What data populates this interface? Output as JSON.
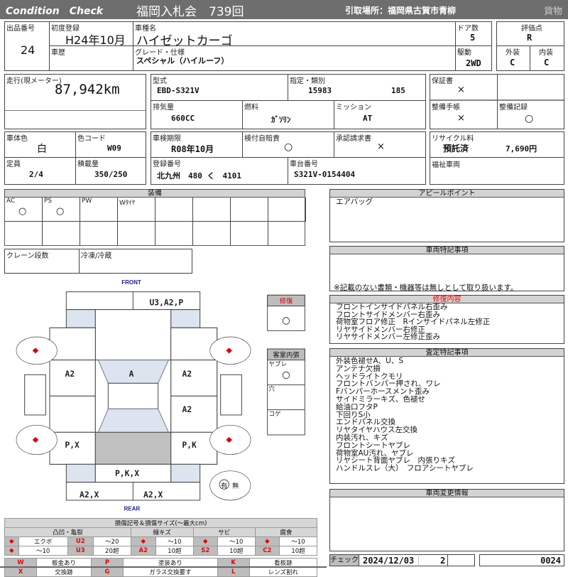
{
  "header": {
    "brand": "Condition　Check",
    "auction": "福岡入札会　739回",
    "pickup": "引取場所：福岡県古賀市青柳",
    "category": "貨物"
  },
  "vehicle": {
    "lot_label": "出品番号",
    "lot": "24",
    "first_reg_label": "初度登録",
    "first_reg": "H24年10月",
    "model_name_label": "車種名",
    "model_name": "ハイゼットカーゴ",
    "doors_label": "ドア数",
    "doors": "5",
    "score_label": "評価点",
    "score": "R",
    "history_label": "車歴",
    "grade_label": "グレード・仕様",
    "grade": "スペシャル（ハイルーフ）",
    "drive_label": "駆動",
    "drive": "2WD",
    "exterior_label": "外装",
    "exterior": "C",
    "interior_label": "内装",
    "interior": "C",
    "mileage_label": "走行(現メーター)",
    "mileage": "87,942km",
    "type_label": "型式",
    "type": "EBD-S321V",
    "designation_label": "指定・類別",
    "designation": "15983",
    "classification": "185",
    "displacement_label": "排気量",
    "displacement": "660CC",
    "fuel_label": "燃料",
    "fuel": "ｶﾞｿﾘﾝ",
    "mission_label": "ミッション",
    "mission": "AT",
    "warranty_label": "保証書",
    "warranty": "×",
    "maint_book_label": "整備手帳",
    "maint_book": "×",
    "maint_record_label": "整備記録",
    "maint_record": "○",
    "color_label": "車体色",
    "color": "白",
    "color_code_label": "色コード",
    "color_code": "W09",
    "inspection_label": "車検期限",
    "inspection": "R08年10月",
    "insurance_label": "検付自賠責",
    "insurance": "○",
    "approval_label": "承認請求書",
    "approval": "×",
    "recycle_label": "リサイクル料",
    "recycle_status": "預託済",
    "recycle_fee": "7,690円",
    "capacity_label": "定員",
    "capacity": "2/4",
    "load_label": "積載量",
    "load": "350/250",
    "plate_label": "登録番号",
    "plate": "北九州　480 く　4101",
    "chassis_label": "車台番号",
    "chassis": "S321V-0154404",
    "welfare_label": "福祉車両"
  },
  "equipment": {
    "title": "装備",
    "items": [
      {
        "label": "AC",
        "value": "○"
      },
      {
        "label": "PS",
        "value": "○"
      },
      {
        "label": "PW",
        "value": ""
      },
      {
        "label": "Wﾀｲﾔ",
        "value": ""
      }
    ],
    "crane_label": "クレーン段数",
    "freezer_label": "冷凍/冷蔵"
  },
  "diagram": {
    "front": "FRONT",
    "rear": "REAR",
    "front_bumper": "U3,A2,P",
    "roof": "A",
    "left_front_door": "A2",
    "right_front_door": "A2",
    "right_rear": "A2",
    "left_quarter": "P,X",
    "right_quarter": "P,K",
    "rear_gate": "P,K,X",
    "rear_bumper_left": "A2,X",
    "rear_bumper_right": "A2,X",
    "spare_yes": "有",
    "spare_no": "無"
  },
  "repair_box": {
    "title": "修復",
    "value": "○"
  },
  "cabin": {
    "title": "客室内張",
    "rows": [
      {
        "label": "ヤブレ",
        "value": "○"
      },
      {
        "label": "穴",
        "value": ""
      },
      {
        "label": "コゲ",
        "value": ""
      }
    ]
  },
  "appeal": {
    "title": "アピールポイント",
    "text": "エアバッグ"
  },
  "special_notes": {
    "title": "車両特記事項",
    "note": "※記載のない書類・機器等は無しとして取り扱います。"
  },
  "repair_details": {
    "title": "修復内容",
    "lines": [
      "フロントインサイドパネル右歪み",
      "フロントサイドメンバー右歪み",
      "荷物室フロア修正　Rインサイドパネル左修正",
      "リヤサイドメンバー右修正",
      "リヤサイドメンバー左修正歪み"
    ]
  },
  "assessment": {
    "title": "査定特記事項",
    "lines": [
      "外装色褪せA、U、S",
      "アンテナ欠損",
      "ヘッドライトクモリ",
      "フロントバンパー押され、ワレ",
      "Fバンパーホースメント歪み",
      "サイドミラーキズ、色褪せ",
      "給油口フタP",
      "下回りS小",
      "エンドパネル交換",
      "リヤタイヤハウス左交換",
      "内装汚れ、キズ",
      "フロントシートヤブレ",
      "荷物室AU汚れ、ヤブレ",
      "リヤシート背面ヤブレ　内張りキズ",
      "ハンドルスレ（大）　フロアシートヤブレ"
    ]
  },
  "change_info": {
    "title": "車両変更情報"
  },
  "check": {
    "label": "チェック",
    "date": "2024/12/03",
    "num": "2",
    "code": "0024"
  },
  "legend": {
    "title": "損傷記号＆損傷サイズ(～最大cm)",
    "groups": [
      "凸凹・亀裂",
      "線キズ",
      "サビ",
      "腐食"
    ],
    "dent": [
      {
        "sym": "◆",
        "txt": "エクボ"
      },
      {
        "sym": "U2",
        "txt": "～20"
      },
      {
        "sym": "◆",
        "txt": "～10"
      },
      {
        "sym": "U3",
        "txt": "20超"
      }
    ],
    "scratch": [
      {
        "sym": "◆",
        "txt": "～10"
      },
      {
        "sym": "A2",
        "txt": "10超"
      }
    ],
    "rust": [
      {
        "sym": "◆",
        "txt": "～10"
      },
      {
        "sym": "S2",
        "txt": "10超"
      }
    ],
    "corrosion": [
      {
        "sym": "◆",
        "txt": "～10"
      },
      {
        "sym": "C2",
        "txt": "10超"
      }
    ],
    "marks": [
      {
        "sym": "W",
        "txt": "板金あり"
      },
      {
        "sym": "P",
        "txt": "塗装あり"
      },
      {
        "sym": "K",
        "txt": "看板跡"
      },
      {
        "sym": "X",
        "txt": "交換跡"
      },
      {
        "sym": "G",
        "txt": "ガラス交換要す"
      },
      {
        "sym": "L",
        "txt": "レンズ割れ"
      }
    ]
  },
  "colors": {
    "header_bg": "#6e6e6e",
    "accent_red": "#e00000",
    "panel_blue": "#dbe4ef",
    "label_blue": "#1a1aa0"
  }
}
